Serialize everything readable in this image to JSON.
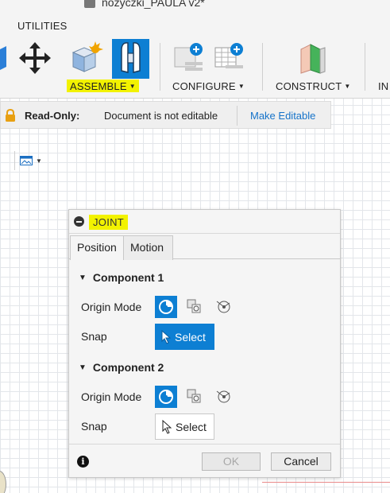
{
  "toolbar": {
    "document_title": "nożyczki_PAULA v2*",
    "tab": "UTILITIES",
    "groups": {
      "assemble": "ASSEMBLE",
      "configure": "CONFIGURE",
      "construct": "CONSTRUCT",
      "insert_partial": "IN"
    }
  },
  "readonly_bar": {
    "title": "Read-Only:",
    "message": "Document is not editable",
    "action": "Make Editable"
  },
  "joint_dialog": {
    "title": "JOINT",
    "tabs": [
      "Position",
      "Motion"
    ],
    "active_tab": "Position",
    "component1": {
      "header": "Component 1",
      "origin_mode_label": "Origin Mode",
      "snap_label": "Snap",
      "snap_button": "Select"
    },
    "component2": {
      "header": "Component 2",
      "origin_mode_label": "Origin Mode",
      "snap_label": "Snap",
      "snap_button": "Select"
    },
    "ok_label": "OK",
    "cancel_label": "Cancel"
  },
  "colors": {
    "accent_blue": "#0d7fd3",
    "highlight_yellow": "#f2f200",
    "link_blue": "#1673c9",
    "lock_orange": "#e8a012"
  }
}
